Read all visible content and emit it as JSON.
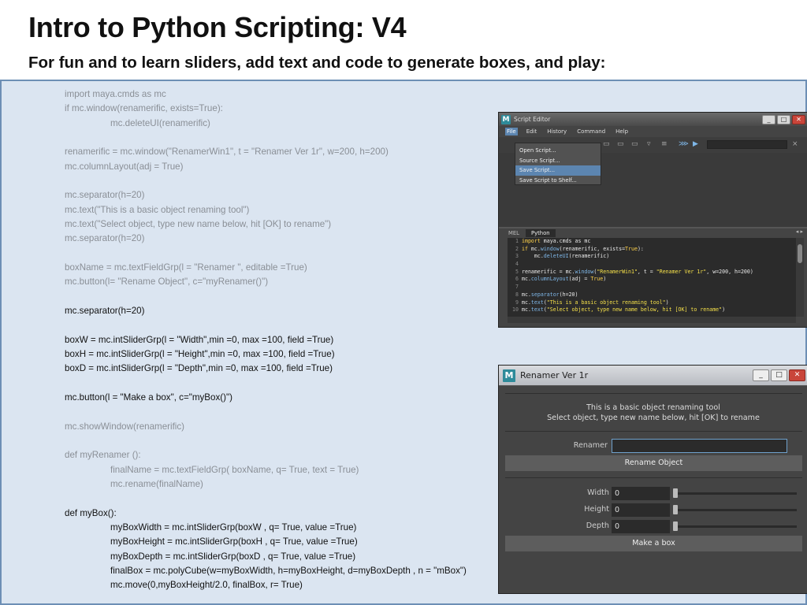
{
  "slide": {
    "title": "Intro to Python Scripting: V4",
    "subtitle": "For fun and to learn sliders, add text and code to generate boxes, and play:"
  },
  "code_lines": [
    "import maya.cmds as mc",
    "if mc.window(renamerific, exists=True):",
    "mc.deleteUI(renamerific)",
    "",
    "renamerific = mc.window(\"RenamerWin1\", t = \"Renamer Ver 1r\", w=200, h=200)",
    "mc.columnLayout(adj = True)",
    "",
    "mc.separator(h=20)",
    "mc.text(\"This is a basic object renaming tool\")",
    "mc.text(\"Select object, type new name below, hit [OK] to rename\")",
    "mc.separator(h=20)",
    "",
    "boxName = mc.textFieldGrp(l = \"Renamer \", editable =True)",
    "mc.button(l= \"Rename Object\", c=\"myRenamer()\")",
    "",
    "mc.separator(h=20)",
    "",
    "boxW = mc.intSliderGrp(l = \"Width\",min =0, max =100, field =True)",
    "boxH = mc.intSliderGrp(l = \"Height\",min =0, max =100, field =True)",
    "boxD = mc.intSliderGrp(l = \"Depth\",min =0, max =100, field =True)",
    "",
    "mc.button(l = \"Make a box\", c=\"myBox()\")",
    "",
    "mc.showWindow(renamerific)",
    "",
    "def myRenamer ():",
    "finalName = mc.textFieldGrp( boxName, q= True, text = True)",
    "mc.rename(finalName)",
    "",
    "def myBox():",
    "myBoxWidth = mc.intSliderGrp(boxW , q= True, value =True)",
    "myBoxHeight = mc.intSliderGrp(boxH , q= True, value =True)",
    "myBoxDepth = mc.intSliderGrp(boxD , q= True, value =True)",
    "finalBox = mc.polyCube(w=myBoxWidth, h=myBoxHeight, d=myBoxDepth , n = \"mBox\")",
    "mc.move(0,myBoxHeight/2.0, finalBox, r= True)"
  ],
  "script_editor": {
    "title": "Script Editor",
    "logo": "M",
    "window_buttons": [
      "_",
      "□",
      "✕"
    ],
    "menus": [
      "File",
      "Edit",
      "History",
      "Command",
      "Help"
    ],
    "file_menu_items": [
      "Open Script...",
      "Source Script...",
      "Save Script...",
      "Save Script to Shelf..."
    ],
    "tabs": [
      "MEL",
      "Python"
    ],
    "code_rows": [
      {
        "n": "1",
        "html": "<span class='c-kw'>import</span> maya.cmds as mc"
      },
      {
        "n": "2",
        "html": "<span class='c-kw'>if</span> mc.<span class='c-fn'>window</span>(renamerific, exists=<span class='c-kw'>True</span>):"
      },
      {
        "n": "3",
        "html": "    mc.<span class='c-fn'>deleteUI</span>(renamerific)"
      },
      {
        "n": "4",
        "html": ""
      },
      {
        "n": "5",
        "html": "renamerific = mc.<span class='c-fn'>window</span>(<span class='c-str'>\"RenamerWin1\"</span>, t = <span class='c-str'>\"Renamer Ver 1r\"</span>, w=200, h=200)"
      },
      {
        "n": "6",
        "html": "mc.<span class='c-fn'>columnLayout</span>(adj = <span class='c-kw'>True</span>)"
      },
      {
        "n": "7",
        "html": ""
      },
      {
        "n": "8",
        "html": "mc.<span class='c-fn'>separator</span>(h=20)"
      },
      {
        "n": "9",
        "html": "mc.<span class='c-fn'>text</span>(<span class='c-str'>\"This is a basic object renaming tool\"</span>)"
      },
      {
        "n": "10",
        "html": "mc.<span class='c-fn'>text</span>(<span class='c-str'>\"Select object, type new name below, hit [OK] to rename\"</span>)"
      }
    ]
  },
  "renamer_window": {
    "title": "Renamer Ver 1r",
    "logo": "M",
    "window_buttons": [
      "_",
      "□",
      "✕"
    ],
    "info_line1": "This is a basic object renaming tool",
    "info_line2": "Select object, type new name below, hit [OK] to rename",
    "renamer_label": "Renamer",
    "renamer_value": "",
    "rename_button": "Rename Object",
    "width_label": "Width",
    "width_value": "0",
    "height_label": "Height",
    "height_value": "0",
    "depth_label": "Depth",
    "depth_value": "0",
    "make_box_button": "Make a box"
  }
}
